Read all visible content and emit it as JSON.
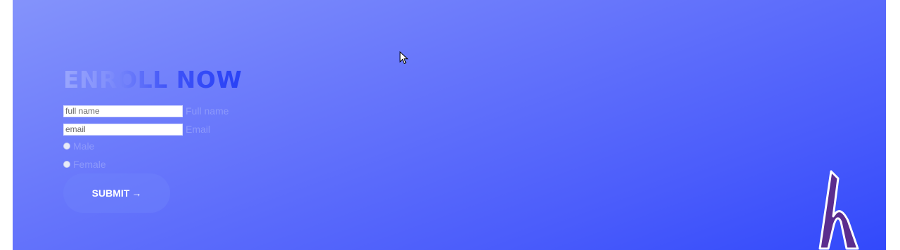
{
  "form": {
    "heading": "ENROLL NOW",
    "fullname": {
      "placeholder": "full name",
      "label": "Full name"
    },
    "email": {
      "placeholder": "email",
      "label": "Email"
    },
    "gender_options": [
      "Male",
      "Female"
    ],
    "submit_label": "SUBMIT",
    "submit_arrow": "→"
  },
  "colors": {
    "background_start": "#8493fb",
    "background_end": "#3249fb",
    "logo_fill": "#5b2d8e"
  },
  "icons": {
    "logo": "h-logo-icon",
    "cursor": "mouse-pointer-icon"
  }
}
